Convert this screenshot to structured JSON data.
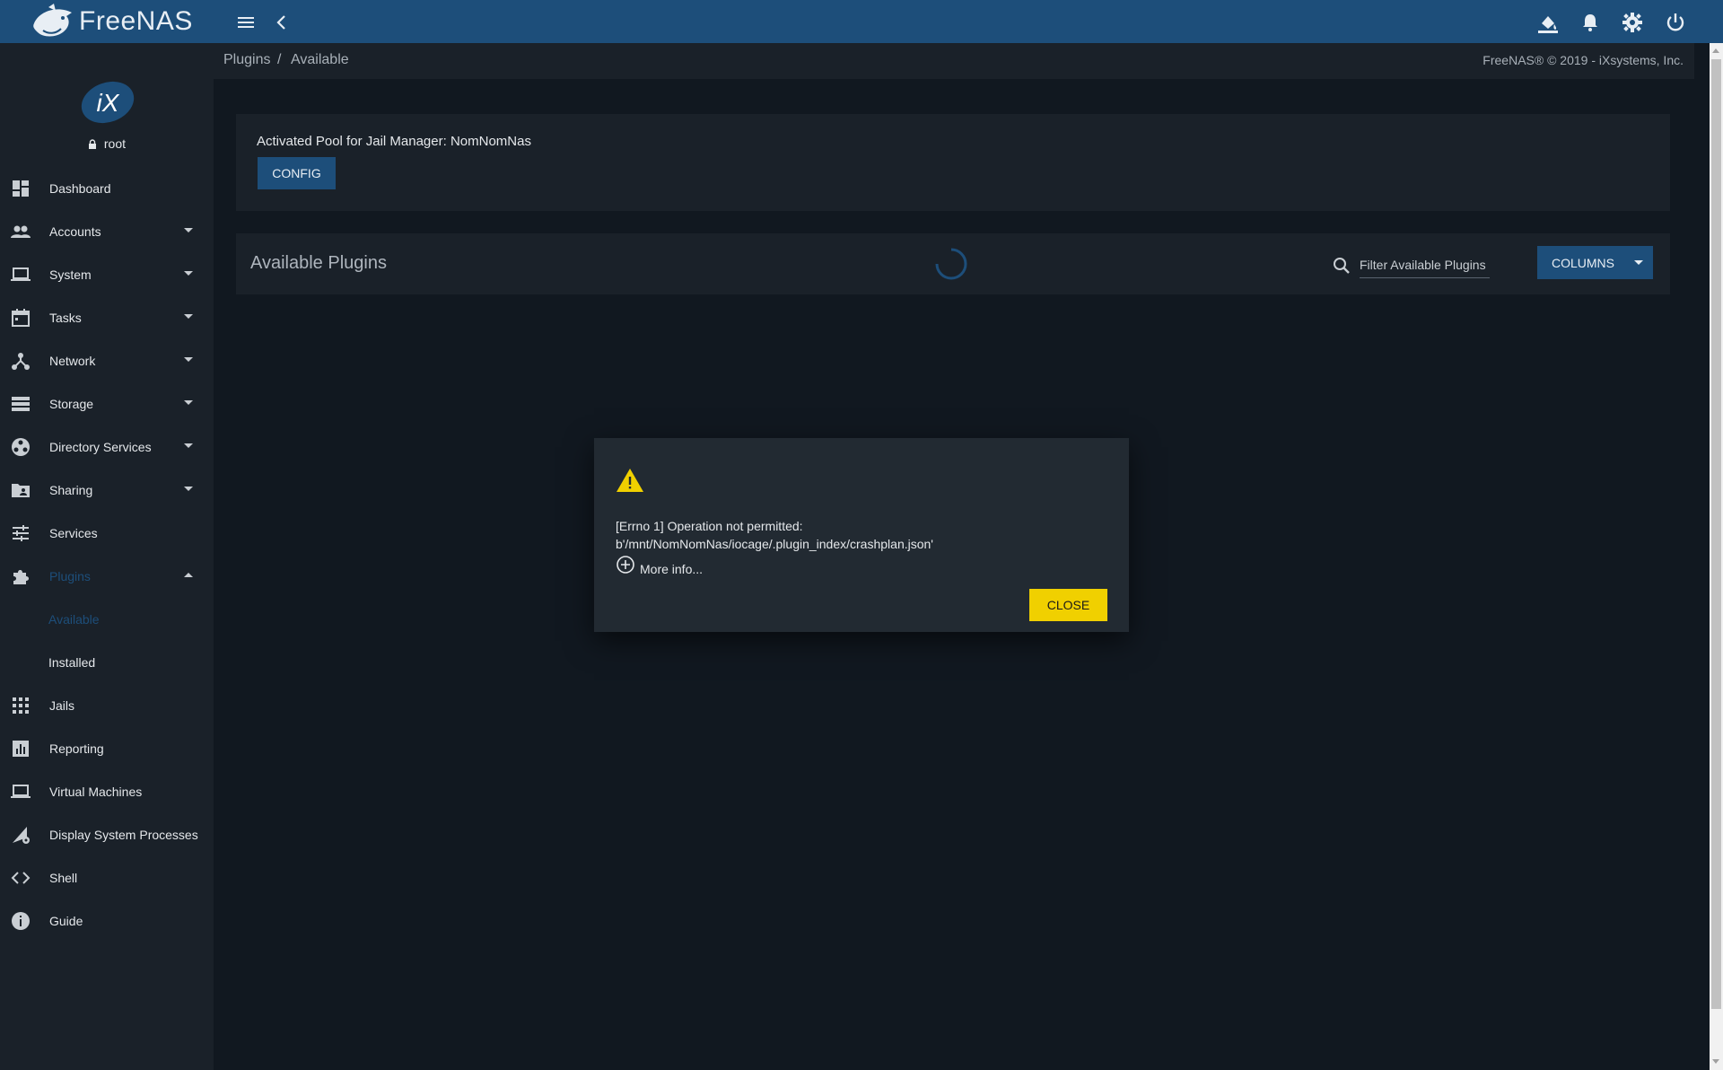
{
  "app": {
    "logo_text": "FreeNAS",
    "brand_color": "#1d4e7a",
    "accent_warning": "#f0d000"
  },
  "topbar": {
    "icons": [
      "menu-icon",
      "back-icon",
      "theme-icon",
      "notifications-icon",
      "settings-icon",
      "power-icon"
    ]
  },
  "user": {
    "name": "root"
  },
  "sidebar": {
    "items": [
      {
        "label": "Dashboard",
        "icon": "dashboard-icon"
      },
      {
        "label": "Accounts",
        "icon": "accounts-icon"
      },
      {
        "label": "System",
        "icon": "system-icon"
      },
      {
        "label": "Tasks",
        "icon": "tasks-icon"
      },
      {
        "label": "Network",
        "icon": "network-icon"
      },
      {
        "label": "Storage",
        "icon": "storage-icon"
      },
      {
        "label": "Directory Services",
        "icon": "directory-services-icon"
      },
      {
        "label": "Sharing",
        "icon": "sharing-icon"
      },
      {
        "label": "Services",
        "icon": "services-icon"
      },
      {
        "label": "Plugins",
        "icon": "plugins-icon",
        "expanded": true,
        "active": true
      },
      {
        "label": "Jails",
        "icon": "jails-icon"
      },
      {
        "label": "Reporting",
        "icon": "reporting-icon"
      },
      {
        "label": "Virtual Machines",
        "icon": "virtual-machines-icon"
      },
      {
        "label": "Display System Processes",
        "icon": "processes-icon"
      },
      {
        "label": "Shell",
        "icon": "shell-icon"
      },
      {
        "label": "Guide",
        "icon": "guide-icon"
      }
    ],
    "plugins_sub": [
      {
        "label": "Available",
        "active": true
      },
      {
        "label": "Installed"
      }
    ]
  },
  "breadcrumb": {
    "items": [
      "Plugins",
      "Available"
    ],
    "separator": "/",
    "copyright": "FreeNAS® © 2019 - iXsystems, Inc."
  },
  "pool": {
    "text": "Activated Pool for Jail Manager: NomNomNas",
    "config_label": "CONFIG"
  },
  "plugins_table": {
    "title": "Available Plugins",
    "filter_placeholder": "Filter Available Plugins",
    "columns_label": "COLUMNS"
  },
  "dialog": {
    "line1": "[Errno 1] Operation not permitted:",
    "line2": "b'/mnt/NomNomNas/iocage/.plugin_index/crashplan.json'",
    "more_info": "More info...",
    "close_label": "CLOSE"
  }
}
